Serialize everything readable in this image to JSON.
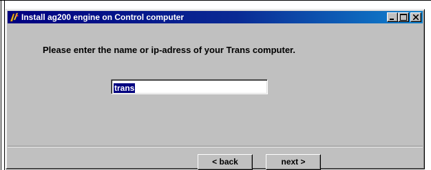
{
  "window": {
    "title": "Install ag200 engine on Control computer",
    "icon": "app-icon",
    "controls": {
      "minimize_icon": "minimize-icon",
      "maximize_icon": "maximize-icon",
      "close_icon": "close-icon"
    }
  },
  "dialog": {
    "prompt": "Please enter the name or ip-adress of your Trans computer.",
    "host_input": {
      "value": "trans"
    }
  },
  "buttons": {
    "back_label": "< back",
    "next_label": "next >"
  },
  "colors": {
    "titlebar_start": "#000080",
    "titlebar_end": "#1084d0",
    "face": "#c0c0c0",
    "selection": "#000080"
  }
}
